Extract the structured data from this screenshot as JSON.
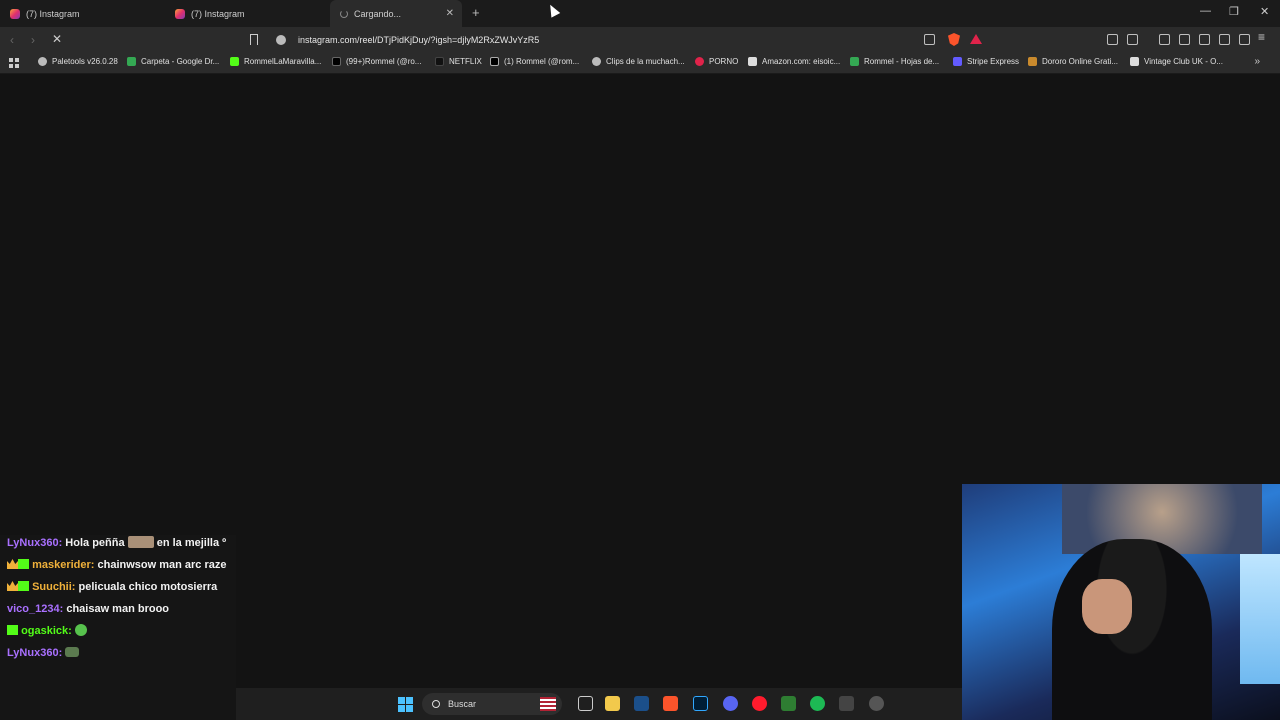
{
  "browser": {
    "tabs": [
      {
        "title": "(7) Instagram",
        "state": "normal"
      },
      {
        "title": "(7) Instagram",
        "state": "normal"
      },
      {
        "title": "Cargando...",
        "state": "loading"
      }
    ],
    "new_tab_icon": "plus-icon",
    "url": "instagram.com/reel/DTjPidKjDuy/?igsh=djlyM2RxZWJvYzR5"
  },
  "bookmarks": [
    "Paletools v26.0.28",
    "Carpeta - Google Dr...",
    "RommelLaMaravilla...",
    "(99+)Rommel (@ro...",
    "NETFLIX",
    "(1) Rommel (@rom...",
    "Clips de la muchach...",
    "PORNO",
    "Amazon.com: eisoic...",
    "Rommel - Hojas de...",
    "Stripe Express",
    "Dororo Online Grati...",
    "Vintage Club UK - O..."
  ],
  "chat": {
    "messages": [
      {
        "user": "LyNux360:",
        "user_color": "#a970ff",
        "text": "Hola peñña",
        "text2": "en la mejilla º"
      },
      {
        "user": "maskerider:",
        "user_color": "#f0b13a",
        "text": "chainwsow man arc raze"
      },
      {
        "user": "Suuchii:",
        "user_color": "#f0b13a",
        "text": "pelicuala chico motosierra"
      },
      {
        "user": "vico_1234:",
        "user_color": "#a970ff",
        "text": "chaisaw man brooo"
      },
      {
        "user": "ogaskick:",
        "user_color": "#53fc18",
        "text": ""
      },
      {
        "user": "LyNux360:",
        "user_color": "#a970ff",
        "text": ""
      }
    ]
  },
  "taskbar": {
    "search_placeholder": "Buscar"
  },
  "colors": {
    "brave": "#fb542b",
    "kick_green": "#53fc18",
    "windows_blue": "#4cc2ff"
  }
}
